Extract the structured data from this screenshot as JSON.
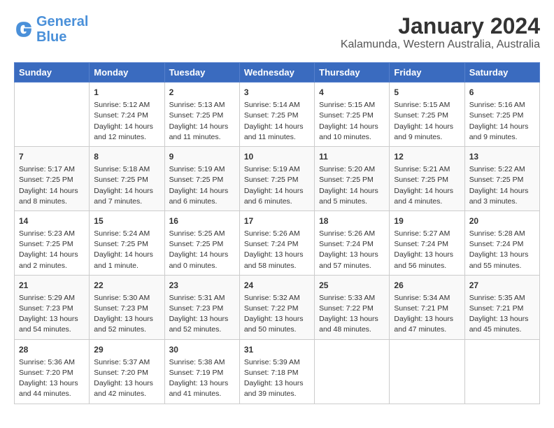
{
  "header": {
    "logo_general": "General",
    "logo_blue": "Blue",
    "title": "January 2024",
    "subtitle": "Kalamunda, Western Australia, Australia"
  },
  "days_of_week": [
    "Sunday",
    "Monday",
    "Tuesday",
    "Wednesday",
    "Thursday",
    "Friday",
    "Saturday"
  ],
  "weeks": [
    [
      {
        "day": "",
        "info": ""
      },
      {
        "day": "1",
        "info": "Sunrise: 5:12 AM\nSunset: 7:24 PM\nDaylight: 14 hours\nand 12 minutes."
      },
      {
        "day": "2",
        "info": "Sunrise: 5:13 AM\nSunset: 7:25 PM\nDaylight: 14 hours\nand 11 minutes."
      },
      {
        "day": "3",
        "info": "Sunrise: 5:14 AM\nSunset: 7:25 PM\nDaylight: 14 hours\nand 11 minutes."
      },
      {
        "day": "4",
        "info": "Sunrise: 5:15 AM\nSunset: 7:25 PM\nDaylight: 14 hours\nand 10 minutes."
      },
      {
        "day": "5",
        "info": "Sunrise: 5:15 AM\nSunset: 7:25 PM\nDaylight: 14 hours\nand 9 minutes."
      },
      {
        "day": "6",
        "info": "Sunrise: 5:16 AM\nSunset: 7:25 PM\nDaylight: 14 hours\nand 9 minutes."
      }
    ],
    [
      {
        "day": "7",
        "info": "Sunrise: 5:17 AM\nSunset: 7:25 PM\nDaylight: 14 hours\nand 8 minutes."
      },
      {
        "day": "8",
        "info": "Sunrise: 5:18 AM\nSunset: 7:25 PM\nDaylight: 14 hours\nand 7 minutes."
      },
      {
        "day": "9",
        "info": "Sunrise: 5:19 AM\nSunset: 7:25 PM\nDaylight: 14 hours\nand 6 minutes."
      },
      {
        "day": "10",
        "info": "Sunrise: 5:19 AM\nSunset: 7:25 PM\nDaylight: 14 hours\nand 6 minutes."
      },
      {
        "day": "11",
        "info": "Sunrise: 5:20 AM\nSunset: 7:25 PM\nDaylight: 14 hours\nand 5 minutes."
      },
      {
        "day": "12",
        "info": "Sunrise: 5:21 AM\nSunset: 7:25 PM\nDaylight: 14 hours\nand 4 minutes."
      },
      {
        "day": "13",
        "info": "Sunrise: 5:22 AM\nSunset: 7:25 PM\nDaylight: 14 hours\nand 3 minutes."
      }
    ],
    [
      {
        "day": "14",
        "info": "Sunrise: 5:23 AM\nSunset: 7:25 PM\nDaylight: 14 hours\nand 2 minutes."
      },
      {
        "day": "15",
        "info": "Sunrise: 5:24 AM\nSunset: 7:25 PM\nDaylight: 14 hours\nand 1 minute."
      },
      {
        "day": "16",
        "info": "Sunrise: 5:25 AM\nSunset: 7:25 PM\nDaylight: 14 hours\nand 0 minutes."
      },
      {
        "day": "17",
        "info": "Sunrise: 5:26 AM\nSunset: 7:24 PM\nDaylight: 13 hours\nand 58 minutes."
      },
      {
        "day": "18",
        "info": "Sunrise: 5:26 AM\nSunset: 7:24 PM\nDaylight: 13 hours\nand 57 minutes."
      },
      {
        "day": "19",
        "info": "Sunrise: 5:27 AM\nSunset: 7:24 PM\nDaylight: 13 hours\nand 56 minutes."
      },
      {
        "day": "20",
        "info": "Sunrise: 5:28 AM\nSunset: 7:24 PM\nDaylight: 13 hours\nand 55 minutes."
      }
    ],
    [
      {
        "day": "21",
        "info": "Sunrise: 5:29 AM\nSunset: 7:23 PM\nDaylight: 13 hours\nand 54 minutes."
      },
      {
        "day": "22",
        "info": "Sunrise: 5:30 AM\nSunset: 7:23 PM\nDaylight: 13 hours\nand 52 minutes."
      },
      {
        "day": "23",
        "info": "Sunrise: 5:31 AM\nSunset: 7:23 PM\nDaylight: 13 hours\nand 52 minutes."
      },
      {
        "day": "24",
        "info": "Sunrise: 5:32 AM\nSunset: 7:22 PM\nDaylight: 13 hours\nand 50 minutes."
      },
      {
        "day": "25",
        "info": "Sunrise: 5:33 AM\nSunset: 7:22 PM\nDaylight: 13 hours\nand 48 minutes."
      },
      {
        "day": "26",
        "info": "Sunrise: 5:34 AM\nSunset: 7:21 PM\nDaylight: 13 hours\nand 47 minutes."
      },
      {
        "day": "27",
        "info": "Sunrise: 5:35 AM\nSunset: 7:21 PM\nDaylight: 13 hours\nand 45 minutes."
      }
    ],
    [
      {
        "day": "28",
        "info": "Sunrise: 5:36 AM\nSunset: 7:20 PM\nDaylight: 13 hours\nand 44 minutes."
      },
      {
        "day": "29",
        "info": "Sunrise: 5:37 AM\nSunset: 7:20 PM\nDaylight: 13 hours\nand 42 minutes."
      },
      {
        "day": "30",
        "info": "Sunrise: 5:38 AM\nSunset: 7:19 PM\nDaylight: 13 hours\nand 41 minutes."
      },
      {
        "day": "31",
        "info": "Sunrise: 5:39 AM\nSunset: 7:18 PM\nDaylight: 13 hours\nand 39 minutes."
      },
      {
        "day": "",
        "info": ""
      },
      {
        "day": "",
        "info": ""
      },
      {
        "day": "",
        "info": ""
      }
    ]
  ]
}
